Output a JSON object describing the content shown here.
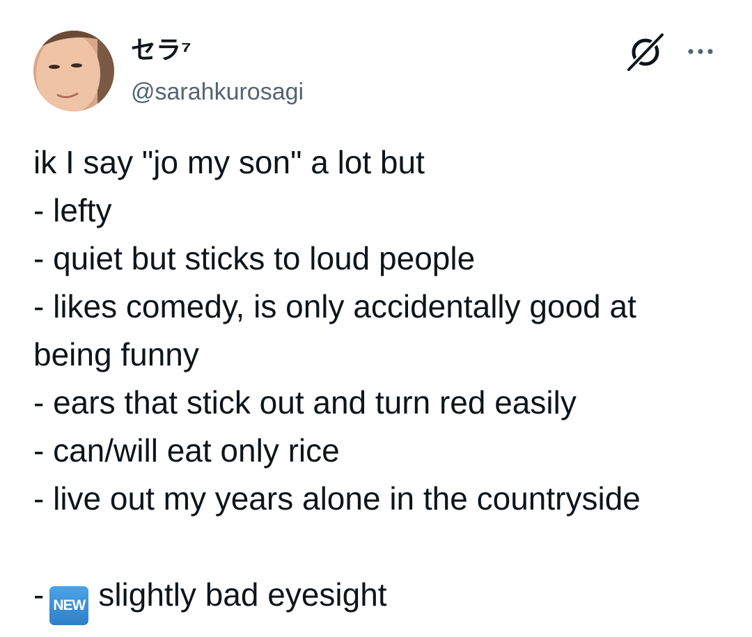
{
  "author": {
    "display_name": "セラ⁷",
    "handle": "@sarahkurosagi"
  },
  "icons": {
    "grok": "grok-icon",
    "more": "more-icon",
    "avatar": "avatar-photo"
  },
  "colors": {
    "text": "#0f1419",
    "secondary_text": "#536471",
    "new_badge": "#3b8fd9"
  },
  "tweet": {
    "lines": [
      "ik I say \"jo my son\" a lot but",
      "- lefty",
      "- quiet but sticks to loud people",
      "- likes comedy, is only accidentally good at",
      "being funny",
      "- ears that stick out and turn red easily",
      "- can/will eat only rice",
      "- live out my years alone in the countryside"
    ],
    "final_prefix": "-",
    "badge_label": "NEW",
    "final_text": "slightly bad eyesight"
  }
}
